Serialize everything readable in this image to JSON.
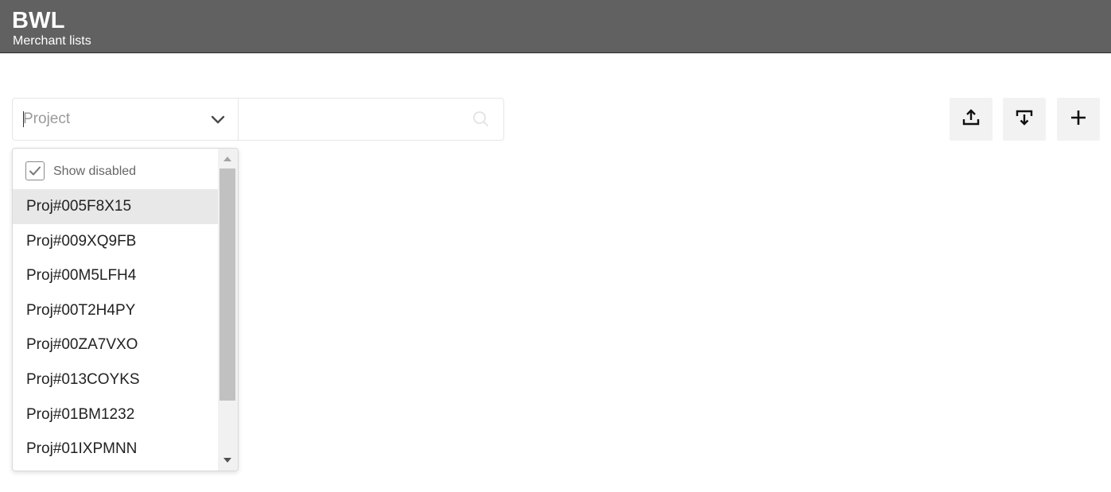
{
  "header": {
    "title": "BWL",
    "subtitle": "Merchant lists",
    "background": "#616161"
  },
  "filter": {
    "project_placeholder": "Project",
    "project_value": "",
    "search_placeholder": "",
    "search_value": ""
  },
  "toolbar": {
    "upload_icon": "upload-icon",
    "download_icon": "download-icon",
    "add_icon": "plus-icon"
  },
  "dropdown": {
    "show_disabled_label": "Show disabled",
    "show_disabled_checked": true,
    "highlighted_index": 0,
    "options": [
      "Proj#005F8X15",
      "Proj#009XQ9FB",
      "Proj#00M5LFH4",
      "Proj#00T2H4PY",
      "Proj#00ZA7VXO",
      "Proj#013COYKS",
      "Proj#01BM1232",
      "Proj#01IXPMNN"
    ]
  }
}
